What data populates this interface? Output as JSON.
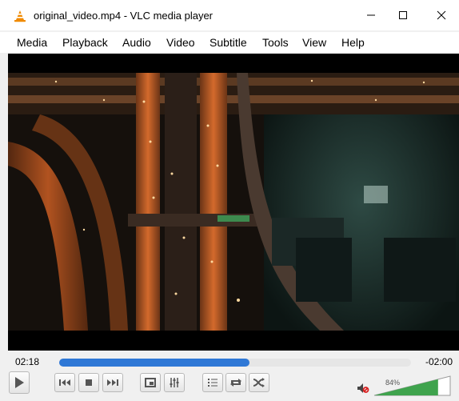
{
  "window": {
    "title": "original_video.mp4 - VLC media player",
    "controls": [
      "minimize",
      "maximize",
      "close"
    ]
  },
  "menu": [
    "Media",
    "Playback",
    "Audio",
    "Video",
    "Subtitle",
    "Tools",
    "View",
    "Help"
  ],
  "playback": {
    "elapsed": "02:18",
    "remaining": "-02:00",
    "progress": 0.54
  },
  "volume": {
    "percent_label": "84%",
    "level": 0.84
  },
  "icons": {
    "app": "vlc-cone-icon",
    "play": "play-icon",
    "prev": "previous-icon",
    "stop": "stop-icon",
    "next": "next-icon",
    "fullscreen": "fullscreen-icon",
    "extended": "extended-settings-icon",
    "playlist": "playlist-icon",
    "loop": "loop-icon",
    "shuffle": "shuffle-icon",
    "mute": "speaker-muted-icon"
  },
  "colors": {
    "accent": "#2f78d6",
    "vlc_orange": "#f08a00",
    "mute_red": "#d81f1f",
    "volume_green": "#3fa34d"
  }
}
